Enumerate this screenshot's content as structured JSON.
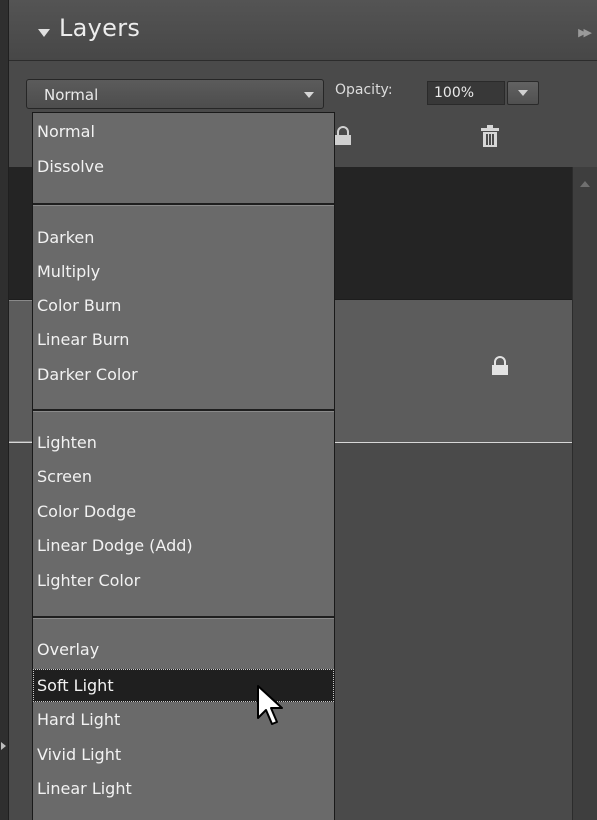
{
  "panel": {
    "title": "Layers",
    "blend_mode": "Normal",
    "opacity_label": "Opacity:",
    "opacity_value": "100%"
  },
  "blend_menu": {
    "groups": [
      [
        "Normal",
        "Dissolve"
      ],
      [
        "Darken",
        "Multiply",
        "Color Burn",
        "Linear Burn",
        "Darker Color"
      ],
      [
        "Lighten",
        "Screen",
        "Color Dodge",
        "Linear Dodge (Add)",
        "Lighter Color"
      ],
      [
        "Overlay",
        "Soft Light",
        "Hard Light",
        "Vivid Light",
        "Linear Light"
      ]
    ],
    "highlighted": "Soft Light"
  },
  "icons": {
    "collapse": "triangle-down-icon",
    "panel_menu": "double-chevron-right-icon",
    "lock": "lock-icon",
    "trash": "trash-icon",
    "cursor": "mouse-pointer-icon"
  },
  "colors": {
    "panel_bg": "#4a4a4a",
    "menu_bg": "#6a6a6a",
    "highlight_bg": "#1f1f1f"
  }
}
